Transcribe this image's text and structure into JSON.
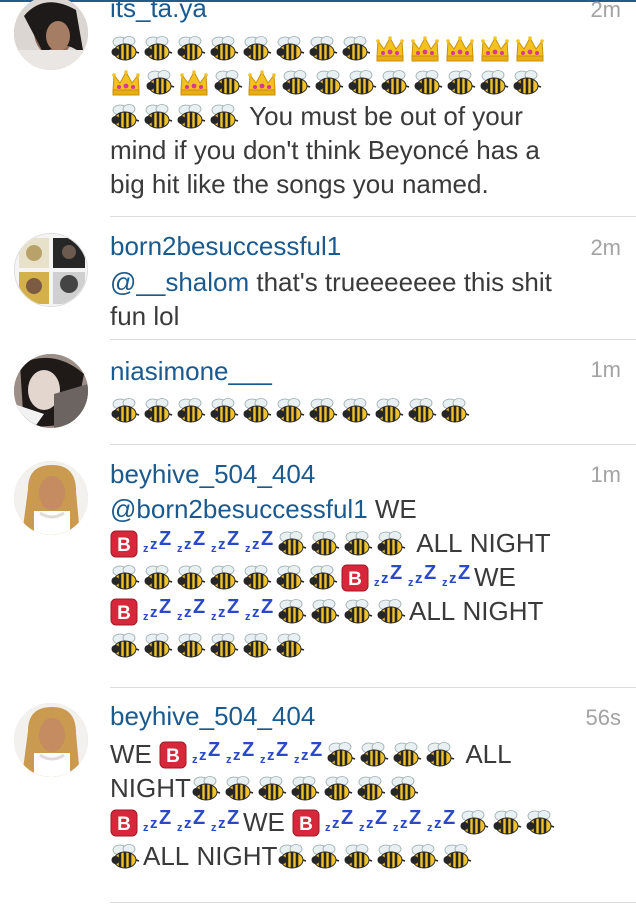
{
  "feed": {
    "comments": [
      {
        "username": "its_ta.ya",
        "time": "2m",
        "lines": [
          [
            "bee",
            "bee",
            "bee",
            "bee",
            "bee",
            "bee",
            "bee",
            "bee",
            "crown",
            "crown",
            "crown",
            "crown",
            "crown"
          ],
          [
            "crown",
            "bee",
            "crown",
            "bee",
            "crown",
            "bee",
            "bee",
            "bee",
            "bee",
            "bee",
            "bee",
            "bee",
            "bee"
          ],
          [
            "bee",
            "bee",
            "bee",
            "bee",
            {
              "t": " You must be out of your"
            }
          ],
          [
            {
              "t": "mind if you don't think Beyoncé has a"
            }
          ],
          [
            {
              "t": "big hit like the songs you named."
            }
          ]
        ]
      },
      {
        "username": "born2besuccessful1",
        "time": "2m",
        "lines": [
          [
            {
              "m": "@__shalom"
            },
            {
              "t": " that's trueeeeeee this shit"
            }
          ],
          [
            {
              "t": "fun lol"
            }
          ]
        ]
      },
      {
        "username": "niasimone___",
        "time": "1m",
        "lines": [
          [
            "bee",
            "bee",
            "bee",
            "bee",
            "bee",
            "bee",
            "bee",
            "bee",
            "bee",
            "bee",
            "bee"
          ]
        ]
      },
      {
        "username": "beyhive_504_404",
        "time": "1m",
        "lines": [
          [
            {
              "m": "@born2besuccessful1"
            },
            {
              "t": " WE"
            }
          ],
          [
            "B",
            "zzz",
            "zzz",
            "zzz",
            "zzz",
            "bee",
            "bee",
            "bee",
            "bee",
            {
              "t": " ALL NIGHT"
            }
          ],
          [
            "bee",
            "bee",
            "bee",
            "bee",
            "bee",
            "bee",
            "bee",
            "B",
            "zzz",
            "zzz",
            "zzz",
            {
              "t": "WE"
            }
          ],
          [
            "B",
            "zzz",
            "zzz",
            "zzz",
            "zzz",
            "bee",
            "bee",
            "bee",
            "bee",
            {
              "t": "ALL NIGHT"
            }
          ],
          [
            "bee",
            "bee",
            "bee",
            "bee",
            "bee",
            "bee"
          ]
        ]
      },
      {
        "username": "beyhive_504_404",
        "time": "56s",
        "lines": [
          [
            {
              "t": "WE "
            },
            "B",
            "zzz",
            "zzz",
            "zzz",
            "zzz",
            "bee",
            "bee",
            "bee",
            "bee",
            {
              "t": " ALL"
            }
          ],
          [
            {
              "t": "NIGHT"
            },
            "bee",
            "bee",
            "bee",
            "bee",
            "bee",
            "bee",
            "bee"
          ],
          [
            "B",
            "zzz",
            "zzz",
            "zzz",
            {
              "t": "WE "
            },
            "B",
            "zzz",
            "zzz",
            "zzz",
            "zzz",
            "bee",
            "bee",
            "bee"
          ],
          [
            "bee",
            {
              "t": "ALL NIGHT"
            },
            "bee",
            "bee",
            "bee",
            "bee",
            "bee",
            "bee"
          ]
        ]
      }
    ]
  },
  "colors": {
    "username": "#1b5a8f",
    "text": "#3a3a3a",
    "time": "#a3a3a3",
    "divider": "#dcdcdc",
    "b_button": "#d6283a",
    "zzz": "#2a49c9"
  },
  "icons": {
    "bee": "honeybee-emoji",
    "crown": "crown-emoji",
    "B": "b-button-emoji",
    "zzz": "zzz-emoji"
  }
}
